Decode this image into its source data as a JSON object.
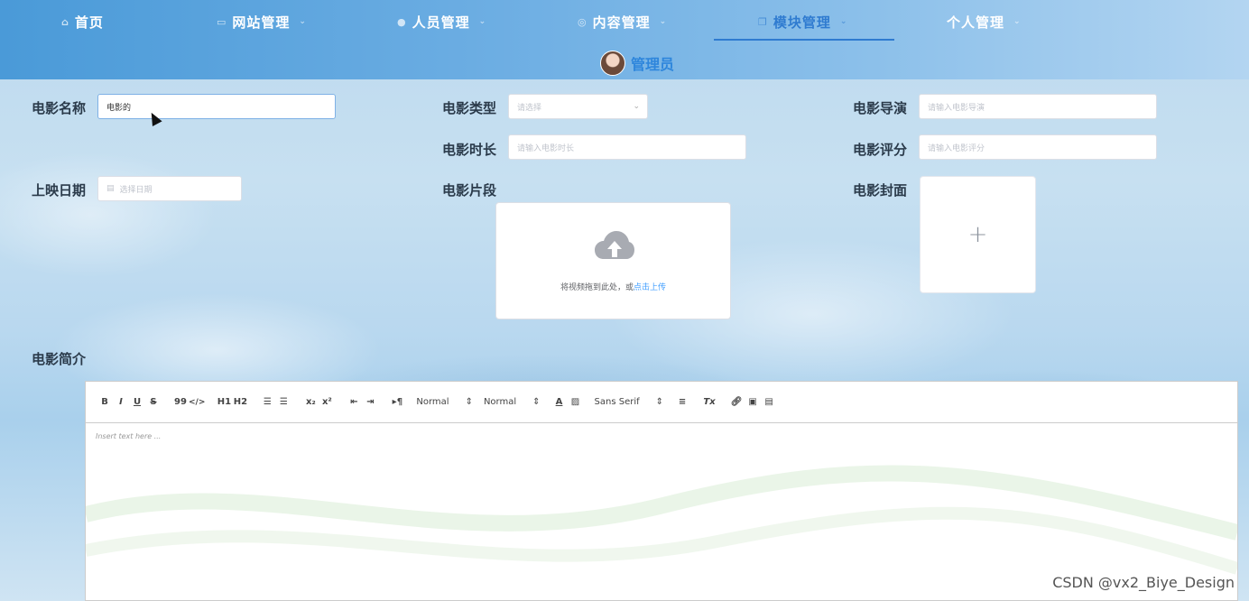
{
  "nav": {
    "items": [
      {
        "label": "首页",
        "icon": "home-icon"
      },
      {
        "label": "网站管理",
        "icon": "monitor-icon"
      },
      {
        "label": "人员管理",
        "icon": "user-icon"
      },
      {
        "label": "内容管理",
        "icon": "circle-icon"
      },
      {
        "label": "模块管理",
        "icon": "copy-icon"
      },
      {
        "label": "个人管理",
        "icon": ""
      }
    ],
    "active": "模块管理",
    "user_name": "管理员"
  },
  "form": {
    "movie_name": {
      "label": "电影名称",
      "value": "电影的"
    },
    "movie_type": {
      "label": "电影类型",
      "placeholder": "请选择"
    },
    "movie_director": {
      "label": "电影导演",
      "placeholder": "请输入电影导演"
    },
    "movie_duration": {
      "label": "电影时长",
      "placeholder": "请输入电影时长"
    },
    "movie_rating": {
      "label": "电影评分",
      "placeholder": "请输入电影评分"
    },
    "release_date": {
      "label": "上映日期",
      "placeholder": "选择日期"
    },
    "movie_clip": {
      "label": "电影片段",
      "upload_text": "将视频拖到此处，或",
      "upload_link": "点击上传"
    },
    "movie_cover": {
      "label": "电影封面",
      "add_symbol": "+"
    },
    "movie_intro": {
      "label": "电影简介"
    }
  },
  "editor": {
    "toolbar": {
      "bold": "B",
      "italic": "I",
      "underline": "U",
      "strike": "S",
      "quote": "99",
      "code": "</>",
      "h1": "H1",
      "h2": "H2",
      "sub": "x₂",
      "sup": "x²",
      "direction": "▸¶",
      "size": "Normal",
      "header": "Normal",
      "color": "A",
      "font": "Sans Serif",
      "clean": "Tx"
    },
    "placeholder": "Insert text here ..."
  },
  "watermark": "CSDN @vx2_Biye_Design",
  "colors": {
    "accent": "#2f7bd0",
    "link": "#409eff"
  }
}
